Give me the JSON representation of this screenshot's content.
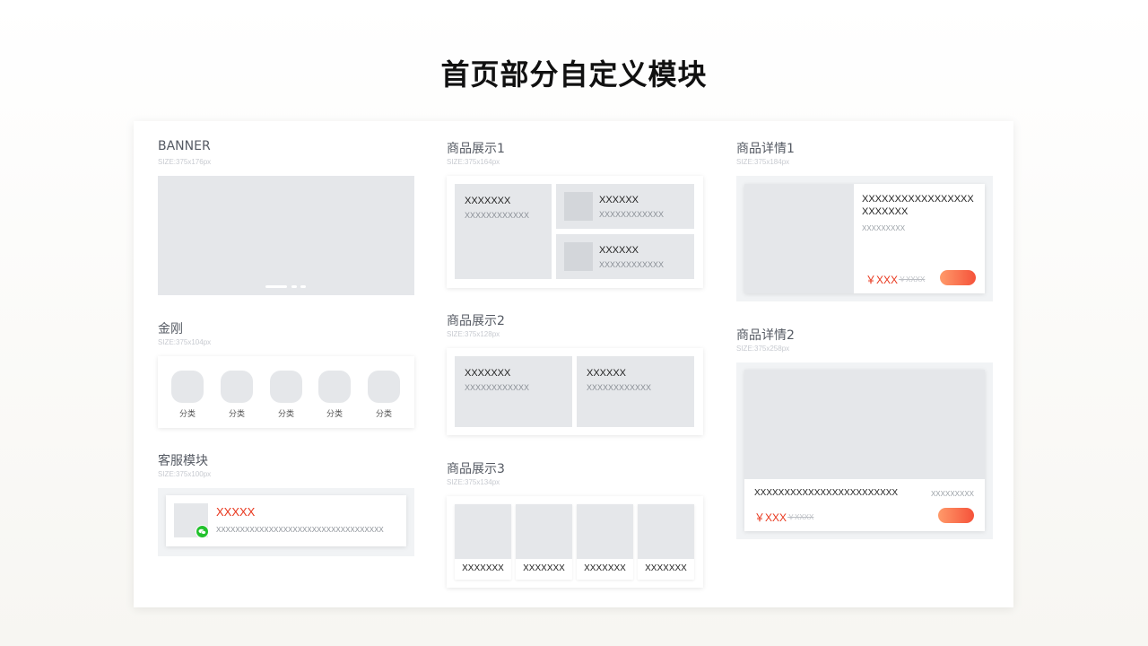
{
  "page": {
    "title": "首页部分自定义模块"
  },
  "banner": {
    "title": "BANNER",
    "size": "SIZE:375x176px"
  },
  "jingang": {
    "title": "金刚",
    "size": "SIZE:375x104px",
    "items": [
      "分类",
      "分类",
      "分类",
      "分类",
      "分类"
    ]
  },
  "service": {
    "title": "客服模块",
    "size": "SIZE:375x100px",
    "name": "XXXXX",
    "desc": "XXXXXXXXXXXXXXXXXXXXXXXXXXXXXXXXXXX",
    "accent": "#e8361c",
    "badge_color": "#22c12d",
    "badge_icon": "wechat-icon"
  },
  "product1": {
    "title": "商品展示1",
    "size": "SIZE:375x164px",
    "main": {
      "name": "XXXXXXX",
      "sub": "XXXXXXXXXXXX"
    },
    "items": [
      {
        "name": "XXXXXX",
        "sub": "XXXXXXXXXXXX"
      },
      {
        "name": "XXXXXX",
        "sub": "XXXXXXXXXXXX"
      }
    ]
  },
  "product2": {
    "title": "商品展示2",
    "size": "SIZE:375x128px",
    "items": [
      {
        "name": "XXXXXXX",
        "sub": "XXXXXXXXXXXX"
      },
      {
        "name": "XXXXXX",
        "sub": "XXXXXXXXXXXX"
      }
    ]
  },
  "product3": {
    "title": "商品展示3",
    "size": "SIZE:375x134px",
    "items": [
      "XXXXXXX",
      "XXXXXXX",
      "XXXXXXX",
      "XXXXXXX"
    ]
  },
  "detail1": {
    "title": "商品详情1",
    "size": "SIZE:375x184px",
    "name": "XXXXXXXXXXXXXXXXXXXXXXXX",
    "sub": "XXXXXXXXX",
    "price": "￥XXX",
    "old_price": "￥XXXX",
    "button_color": "#f5523a"
  },
  "detail2": {
    "title": "商品详情2",
    "size": "SIZE:375x258px",
    "name": "XXXXXXXXXXXXXXXXXXXXXXXX",
    "sub": "XXXXXXXXX",
    "price": "￥XXX",
    "old_price": "￥XXXX"
  }
}
